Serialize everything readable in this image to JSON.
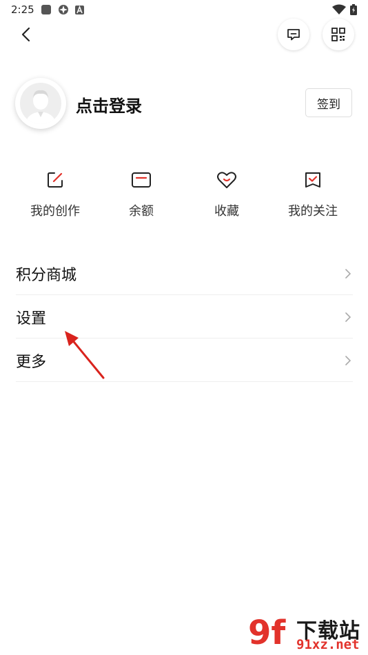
{
  "status_bar": {
    "time": "2:25"
  },
  "profile": {
    "login_text": "点击登录",
    "checkin_label": "签到"
  },
  "quick_actions": [
    {
      "label": "我的创作",
      "icon": "edit-icon"
    },
    {
      "label": "余额",
      "icon": "wallet-icon"
    },
    {
      "label": "收藏",
      "icon": "heart-icon"
    },
    {
      "label": "我的关注",
      "icon": "follow-icon"
    }
  ],
  "menu": [
    {
      "label": "积分商城"
    },
    {
      "label": "设置"
    },
    {
      "label": "更多"
    }
  ],
  "watermark": {
    "logo": "9f",
    "title": "下载站",
    "url": "91xz.net"
  },
  "colors": {
    "accent": "#e2322b",
    "text": "#111111",
    "divider": "#eeeeee"
  }
}
